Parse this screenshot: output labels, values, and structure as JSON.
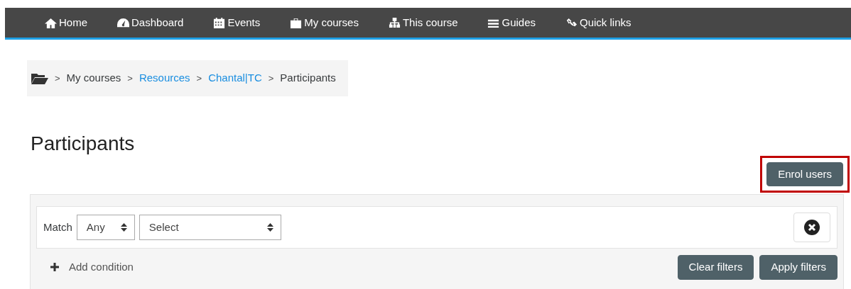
{
  "navbar": {
    "items": [
      {
        "label": "Home"
      },
      {
        "label": "Dashboard"
      },
      {
        "label": "Events"
      },
      {
        "label": "My courses"
      },
      {
        "label": "This course"
      },
      {
        "label": "Guides"
      },
      {
        "label": "Quick links"
      }
    ]
  },
  "breadcrumb": [
    {
      "separator": ">",
      "label": "My courses",
      "link": false
    },
    {
      "separator": ">",
      "label": "Resources",
      "link": true
    },
    {
      "separator": ">",
      "label": "Chantal|TC",
      "link": true
    },
    {
      "separator": ">",
      "label": "Participants",
      "link": false
    }
  ],
  "page_title": "Participants",
  "enrol_button": {
    "label": "Enrol users",
    "highlighted": true
  },
  "filters": {
    "match_label": "Match",
    "match_value": "Any",
    "condition_value": "Select",
    "add_condition": "Add condition",
    "buttons": [
      "Clear filters",
      "Apply filters"
    ]
  }
}
